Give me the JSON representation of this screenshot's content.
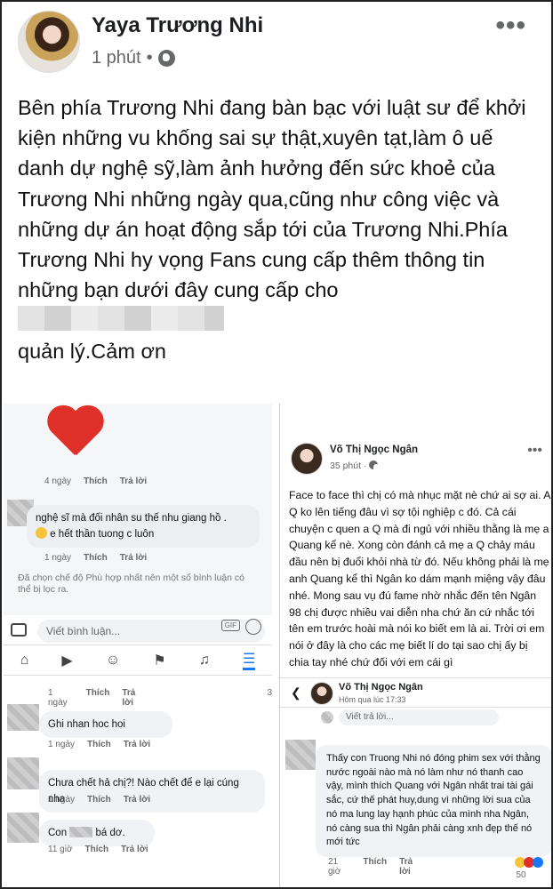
{
  "post": {
    "author": "Yaya Trương Nhi",
    "time": "1 phút",
    "more_label": "•••",
    "text_before": "Bên phía Trương Nhi đang bàn bạc với luật sư để khởi kiện những vu khống sai sự thật,xuyên tạt,làm ô uế danh dự nghệ sỹ,làm ảnh hưởng đến sức khoẻ của Trương Nhi những ngày qua,cũng như công việc và những dự án hoạt động sắp tới của Trương Nhi.Phía Trương Nhi hy vọng Fans cung cấp thêm thông tin những bạn dưới đây cung cấp cho",
    "text_after": "quản lý.Cảm ơn"
  },
  "left_panel": {
    "sticker_meta": {
      "time": "4 ngày",
      "like": "Thích",
      "reply": "Trả lời"
    },
    "comment1": {
      "line1": "nghệ sĩ mà đối nhân su thế nhu giang hồ .",
      "line2": "e hết thần tuong c luôn"
    },
    "comment1_meta": {
      "time": "1 ngày",
      "like": "Thích",
      "reply": "Trả lời"
    },
    "filter_note": "Đã chọn chế độ Phù hợp nhất nên một số bình luận có thể bị lọc ra.",
    "comment_placeholder": "Viết bình luận...",
    "gif_label": "GIF",
    "row1_meta": {
      "time": "1 ngày",
      "like": "Thích",
      "reply": "Trả lời",
      "count": "3"
    },
    "c2": "Ghi nhan hoc hoi",
    "c2_meta": {
      "time": "1 ngày",
      "like": "Thích",
      "reply": "Trả lời"
    },
    "c3": "Chưa chết hả chị?! Nào chết để e lại cúng nha",
    "c3_meta": {
      "time": "1 ngày",
      "like": "Thích",
      "reply": "Trả lời"
    },
    "c4a": "Con",
    "c4b": "bá dơ.",
    "c4_meta": {
      "time": "11 giờ",
      "like": "Thích",
      "reply": "Trả lời"
    }
  },
  "right_panel": {
    "author": "Võ Thị Ngọc Ngân",
    "time": "35 phút",
    "text": "Face to face thì chị có mà nhục mặt nè chứ ai sợ ai.   A Q ko lên tiếng đâu vì sợ tội nghiệp c đó. Cả cái chuyện c quen a Q mà đi ngủ với nhiều thằng là mẹ a Quang kể nè. Xong còn đánh cả mẹ a Q chảy máu đầu nên bị đuổi khỏi nhà từ đó. Nếu không phải là mẹ anh Quang kể thì Ngân ko dám mạnh miệng vậy đâu nhé. Mong sau vụ đú fame nhờ nhắc đến tên Ngân 98 chị được nhiều vai diễn nha chứ ăn cứ nhắc tới tên em trước hoài mà nói ko biết em là ai. Trời ơi em nói ở đây là cho các mẹ biết lí do tại sao chị ấy bị chia tay nhé chứ đối với em cái gì",
    "reply_author": "Võ Thị Ngọc Ngân",
    "reply_time": "Hôm qua lúc 17:33",
    "reply_placeholder": "Viết trả lời...",
    "reply_text": "Thấy con Truong Nhi nó đóng phim sex với thằng nước ngoài nào mà nó làm như nó thanh cao vậy, mình thích Quang với Ngân nhất trai tài gái sắc, cứ thế phát huy,dung vì những lời sua của nó ma lung lay hạnh phúc của mình nha Ngân, nó càng sua thì Ngân phải càng xnh đẹp thế nó mới tức",
    "reply_meta": {
      "time": "21 giờ",
      "like": "Thích",
      "reply": "Trả lời",
      "count": "50"
    }
  }
}
